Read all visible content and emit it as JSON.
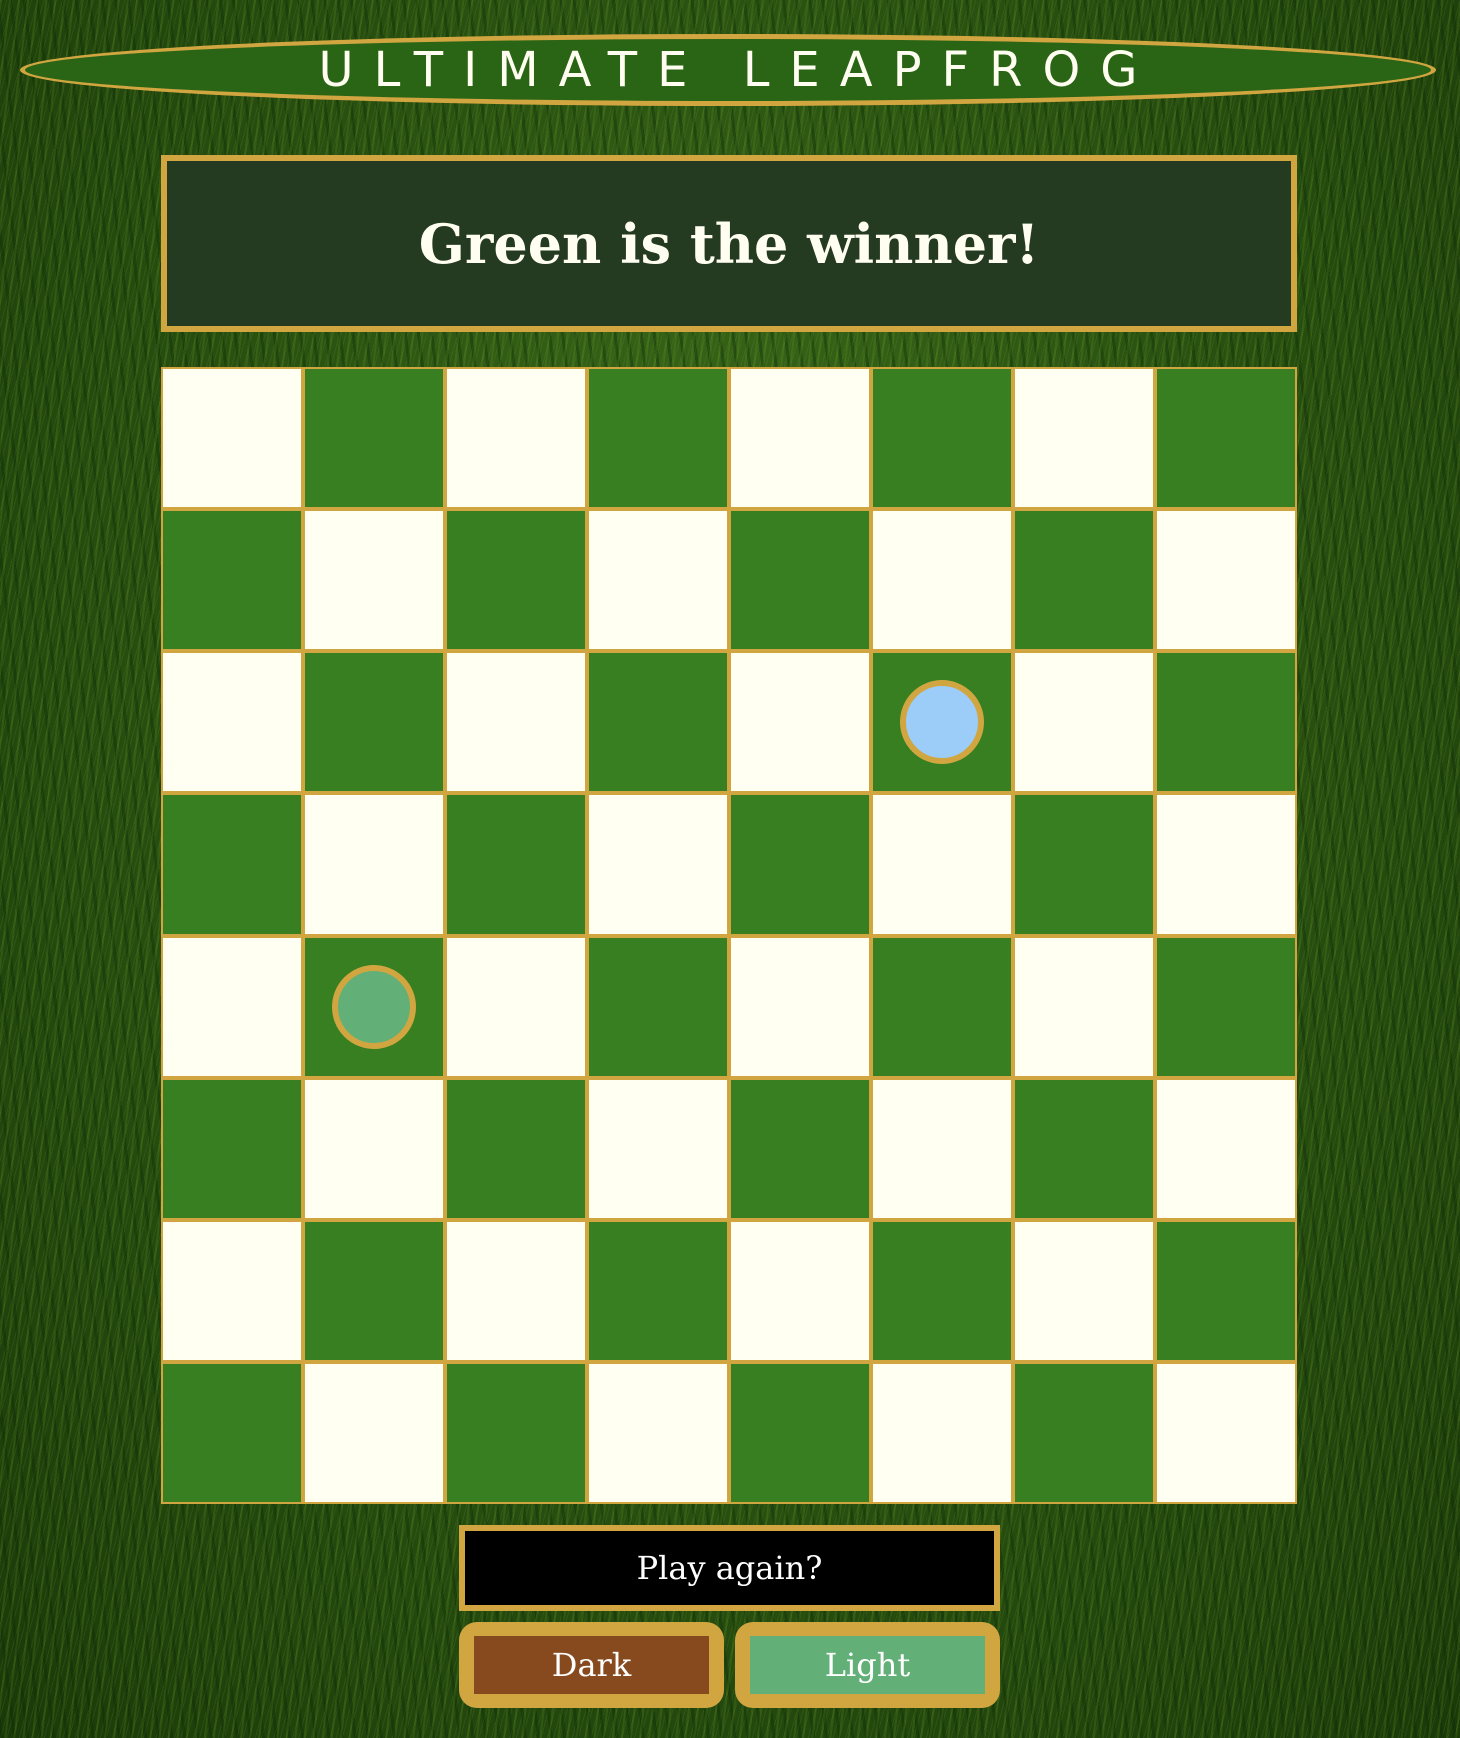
{
  "title": "ULTIMATE LEAPFROG",
  "status": "Green is the winner!",
  "board": {
    "size": 8,
    "pieces": [
      {
        "row": 3,
        "col": 6,
        "color": "blue"
      },
      {
        "row": 5,
        "col": 2,
        "color": "green"
      }
    ]
  },
  "buttons": {
    "play_again": "Play again?",
    "dark": "Dark",
    "light": "Light"
  },
  "colors": {
    "gold": "#d1a640",
    "board_dark": "#377f21",
    "board_light": "#fffff2",
    "piece_blue": "#9bcdf8",
    "piece_green": "#62b077",
    "dark_choice": "#874a1e",
    "status_bg": "#243a21"
  }
}
